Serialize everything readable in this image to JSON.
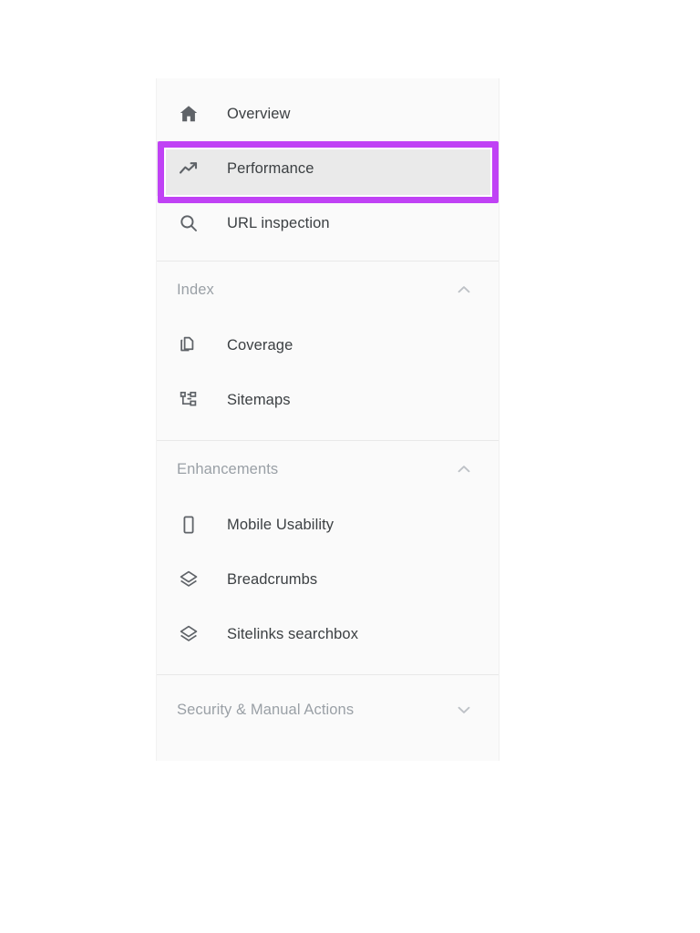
{
  "sidebar": {
    "groups": [
      {
        "id": "primary",
        "items": [
          {
            "label": "Overview",
            "icon": "home-icon",
            "selected": false
          },
          {
            "label": "Performance",
            "icon": "trending-up-icon",
            "selected": true
          },
          {
            "label": "URL inspection",
            "icon": "search-icon",
            "selected": false
          }
        ]
      },
      {
        "id": "index",
        "header": {
          "title": "Index",
          "chevron": "chevron-up-icon",
          "expanded": true
        },
        "items": [
          {
            "label": "Coverage",
            "icon": "copy-documents-icon",
            "selected": false
          },
          {
            "label": "Sitemaps",
            "icon": "account-tree-icon",
            "selected": false
          }
        ]
      },
      {
        "id": "enhancements",
        "header": {
          "title": "Enhancements",
          "chevron": "chevron-up-icon",
          "expanded": true
        },
        "items": [
          {
            "label": "Mobile Usability",
            "icon": "mobile-phone-icon",
            "selected": false
          },
          {
            "label": "Breadcrumbs",
            "icon": "layers-icon",
            "selected": false
          },
          {
            "label": "Sitelinks searchbox",
            "icon": "layers-icon",
            "selected": false
          }
        ]
      },
      {
        "id": "security",
        "header": {
          "title": "Security & Manual Actions",
          "chevron": "chevron-down-icon",
          "expanded": false
        },
        "items": []
      }
    ]
  },
  "annotation": {
    "highlight_target": "Performance",
    "highlight_color": "#c042f5",
    "shape": "rectangle-outline"
  },
  "colors": {
    "sidebar_background": "#fafafa",
    "selected_row_background": "#eaeaea",
    "label_text": "#3c4043",
    "section_title_text": "#9aa0a6",
    "icon": "#5f6368",
    "divider": "#e8e8e8",
    "page_background": "#ffffff"
  }
}
